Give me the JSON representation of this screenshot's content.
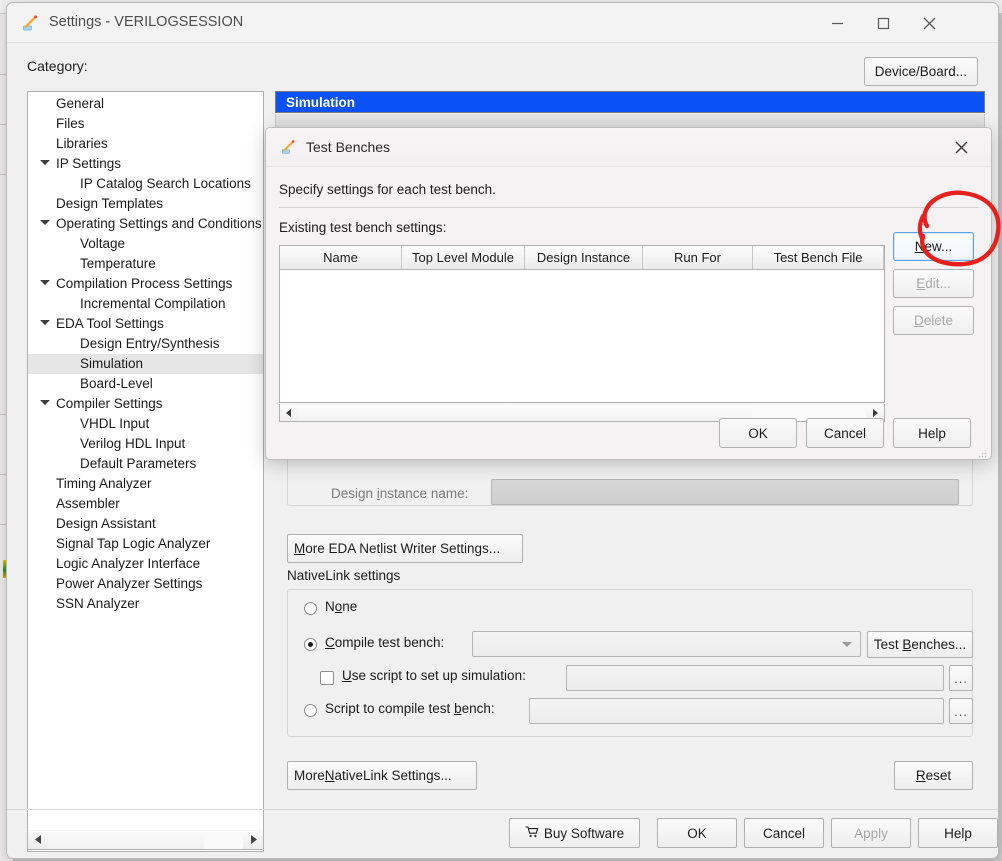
{
  "window": {
    "title": "Settings - VERILOGSESSION",
    "icon": "quartus-pencil-icon",
    "minimize": "minimize-icon",
    "maximize": "maximize-icon",
    "close": "close-icon"
  },
  "category": {
    "label": "Category:",
    "items": [
      {
        "label": "General",
        "depth": 0,
        "arrow": false,
        "selected": false
      },
      {
        "label": "Files",
        "depth": 0,
        "arrow": false,
        "selected": false
      },
      {
        "label": "Libraries",
        "depth": 0,
        "arrow": false,
        "selected": false
      },
      {
        "label": "IP Settings",
        "depth": 0,
        "arrow": true,
        "selected": false
      },
      {
        "label": "IP Catalog Search Locations",
        "depth": 1,
        "arrow": false,
        "selected": false
      },
      {
        "label": "Design Templates",
        "depth": 0,
        "arrow": false,
        "selected": false
      },
      {
        "label": "Operating Settings and Conditions",
        "depth": 0,
        "arrow": true,
        "selected": false
      },
      {
        "label": "Voltage",
        "depth": 1,
        "arrow": false,
        "selected": false
      },
      {
        "label": "Temperature",
        "depth": 1,
        "arrow": false,
        "selected": false
      },
      {
        "label": "Compilation Process Settings",
        "depth": 0,
        "arrow": true,
        "selected": false
      },
      {
        "label": "Incremental Compilation",
        "depth": 1,
        "arrow": false,
        "selected": false
      },
      {
        "label": "EDA Tool Settings",
        "depth": 0,
        "arrow": true,
        "selected": false
      },
      {
        "label": "Design Entry/Synthesis",
        "depth": 1,
        "arrow": false,
        "selected": false
      },
      {
        "label": "Simulation",
        "depth": 1,
        "arrow": false,
        "selected": true
      },
      {
        "label": "Board-Level",
        "depth": 1,
        "arrow": false,
        "selected": false
      },
      {
        "label": "Compiler Settings",
        "depth": 0,
        "arrow": true,
        "selected": false
      },
      {
        "label": "VHDL Input",
        "depth": 1,
        "arrow": false,
        "selected": false
      },
      {
        "label": "Verilog HDL Input",
        "depth": 1,
        "arrow": false,
        "selected": false
      },
      {
        "label": "Default Parameters",
        "depth": 1,
        "arrow": false,
        "selected": false
      },
      {
        "label": "Timing Analyzer",
        "depth": 0,
        "arrow": false,
        "selected": false
      },
      {
        "label": "Assembler",
        "depth": 0,
        "arrow": false,
        "selected": false
      },
      {
        "label": "Design Assistant",
        "depth": 0,
        "arrow": false,
        "selected": false
      },
      {
        "label": "Signal Tap Logic Analyzer",
        "depth": 0,
        "arrow": false,
        "selected": false
      },
      {
        "label": "Logic Analyzer Interface",
        "depth": 0,
        "arrow": false,
        "selected": false
      },
      {
        "label": "Power Analyzer Settings",
        "depth": 0,
        "arrow": false,
        "selected": false
      },
      {
        "label": "SSN Analyzer",
        "depth": 0,
        "arrow": false,
        "selected": false
      }
    ]
  },
  "toolbar": {
    "device_board": "Device/Board..."
  },
  "pane": {
    "header": "Simulation",
    "design_instance_label_pre": "Design ",
    "design_instance_label_mn": "i",
    "design_instance_label_post": "nstance name:",
    "design_instance_value": "",
    "more_eda_pre": "M",
    "more_eda_post": "ore EDA Netlist Writer Settings...",
    "nativelink_title": "NativeLink settings",
    "options": {
      "none_pre": "N",
      "none_mn": "o",
      "none_post": "ne",
      "compile_pre": "C",
      "compile_mn": "",
      "compile_post": "ompile test bench:",
      "use_script_pre": "",
      "use_script_mn": "U",
      "use_script_post": "se script to set up simulation:",
      "script_compile": "Script to compile test bench:"
    },
    "compile_testbench_value": "",
    "test_benches_button": "Test Benches...",
    "use_script_value": "",
    "script_compile_value": "",
    "ellipsis_button": "...",
    "more_nativelink_pre": "More ",
    "more_nativelink_mn": "N",
    "more_nativelink_post": "ativeLink Settings...",
    "reset_button": "Reset"
  },
  "footer": {
    "buy_software": "Buy Software",
    "cart_icon": "shopping-cart-icon",
    "ok": "OK",
    "cancel": "Cancel",
    "apply": "Apply",
    "help": "Help"
  },
  "dialog": {
    "icon": "quartus-pencil-icon",
    "title": "Test Benches",
    "close": "close-icon",
    "description": "Specify settings for each test bench.",
    "subtitle": "Existing test bench settings:",
    "table": {
      "columns": [
        "Name",
        "Top Level Module",
        "Design Instance",
        "Run For",
        "Test Bench File"
      ],
      "rows": []
    },
    "side_buttons": [
      {
        "label": "New...",
        "mnemonic": "N",
        "state": "focused"
      },
      {
        "label": "Edit...",
        "mnemonic": "E",
        "state": "disabled"
      },
      {
        "label": "Delete",
        "mnemonic": "D",
        "state": "disabled"
      }
    ],
    "bottom_buttons": [
      {
        "label": "OK"
      },
      {
        "label": "Cancel"
      },
      {
        "label": "Help"
      }
    ]
  },
  "annotation": {
    "shape": "red-ellipse-highlight",
    "target": "New...",
    "color": "#e8201c"
  },
  "colors": {
    "pane_header_blue": "#0a52f5",
    "annotation_red": "#e8201c",
    "window_bg": "#f0f0f0",
    "dialog_bg": "#f4f2f3"
  }
}
